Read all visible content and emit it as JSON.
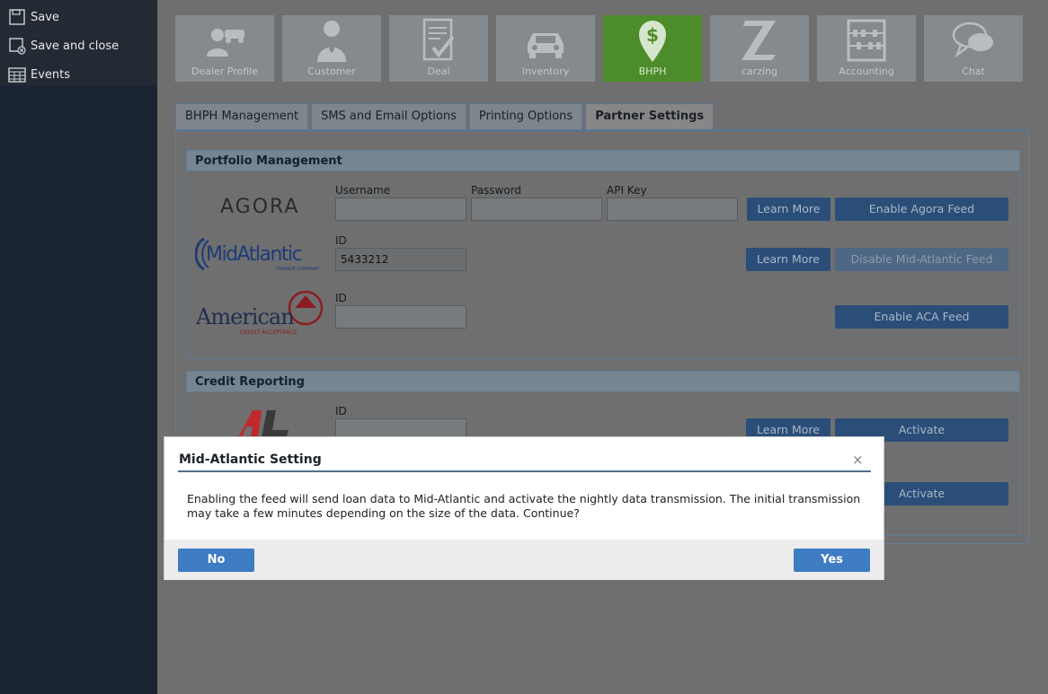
{
  "sidebar": {
    "items": [
      {
        "label": "Save",
        "icon": "save-icon"
      },
      {
        "label": "Save and close",
        "icon": "save-close-icon"
      },
      {
        "label": "Events",
        "icon": "calendar-icon"
      }
    ]
  },
  "modules": [
    {
      "label": "Dealer Profile",
      "icon": "dealer-profile-icon",
      "active": false
    },
    {
      "label": "Customer",
      "icon": "customer-icon",
      "active": false
    },
    {
      "label": "Deal",
      "icon": "deal-icon",
      "active": false
    },
    {
      "label": "Inventory",
      "icon": "car-icon",
      "active": false
    },
    {
      "label": "BHPH",
      "icon": "dollar-pin-icon",
      "active": true
    },
    {
      "label": "carzing",
      "icon": "carzing-z-icon",
      "active": false
    },
    {
      "label": "Accounting",
      "icon": "abacus-icon",
      "active": false
    },
    {
      "label": "Chat",
      "icon": "chat-icon",
      "active": false
    }
  ],
  "tabs": [
    {
      "label": "BHPH Management",
      "active": false
    },
    {
      "label": "SMS and Email Options",
      "active": false
    },
    {
      "label": "Printing Options",
      "active": false
    },
    {
      "label": "Partner Settings",
      "active": true
    }
  ],
  "portfolio": {
    "title": "Portfolio Management",
    "agora": {
      "logo_text": "AGORA",
      "username_label": "Username",
      "username_value": "",
      "password_label": "Password",
      "password_value": "",
      "apikey_label": "API Key",
      "apikey_value": "",
      "learn_more": "Learn More",
      "enable": "Enable Agora Feed"
    },
    "midatlantic": {
      "logo_text": "MidAtlantic",
      "logo_sub": "FINANCE COMPANY",
      "id_label": "ID",
      "id_value": "5433212",
      "learn_more": "Learn More",
      "disable": "Disable Mid-Atlantic Feed"
    },
    "aca": {
      "logo_text": "American",
      "logo_sub": "CREDIT ACCEPTANCE",
      "id_label": "ID",
      "id_value": "",
      "enable": "Enable ACA Feed"
    }
  },
  "credit": {
    "title": "Credit Reporting",
    "row1": {
      "id_label": "ID",
      "learn_more": "Learn More",
      "activate": "Activate"
    },
    "row2": {
      "activate": "Activate"
    }
  },
  "modal": {
    "title": "Mid-Atlantic Setting",
    "close": "×",
    "body": "Enabling the feed will send loan data to Mid-Atlantic and activate the nightly data transmission. The initial transmission may take a few minutes depending on the size of the data. Continue?",
    "no": "No",
    "yes": "Yes"
  }
}
